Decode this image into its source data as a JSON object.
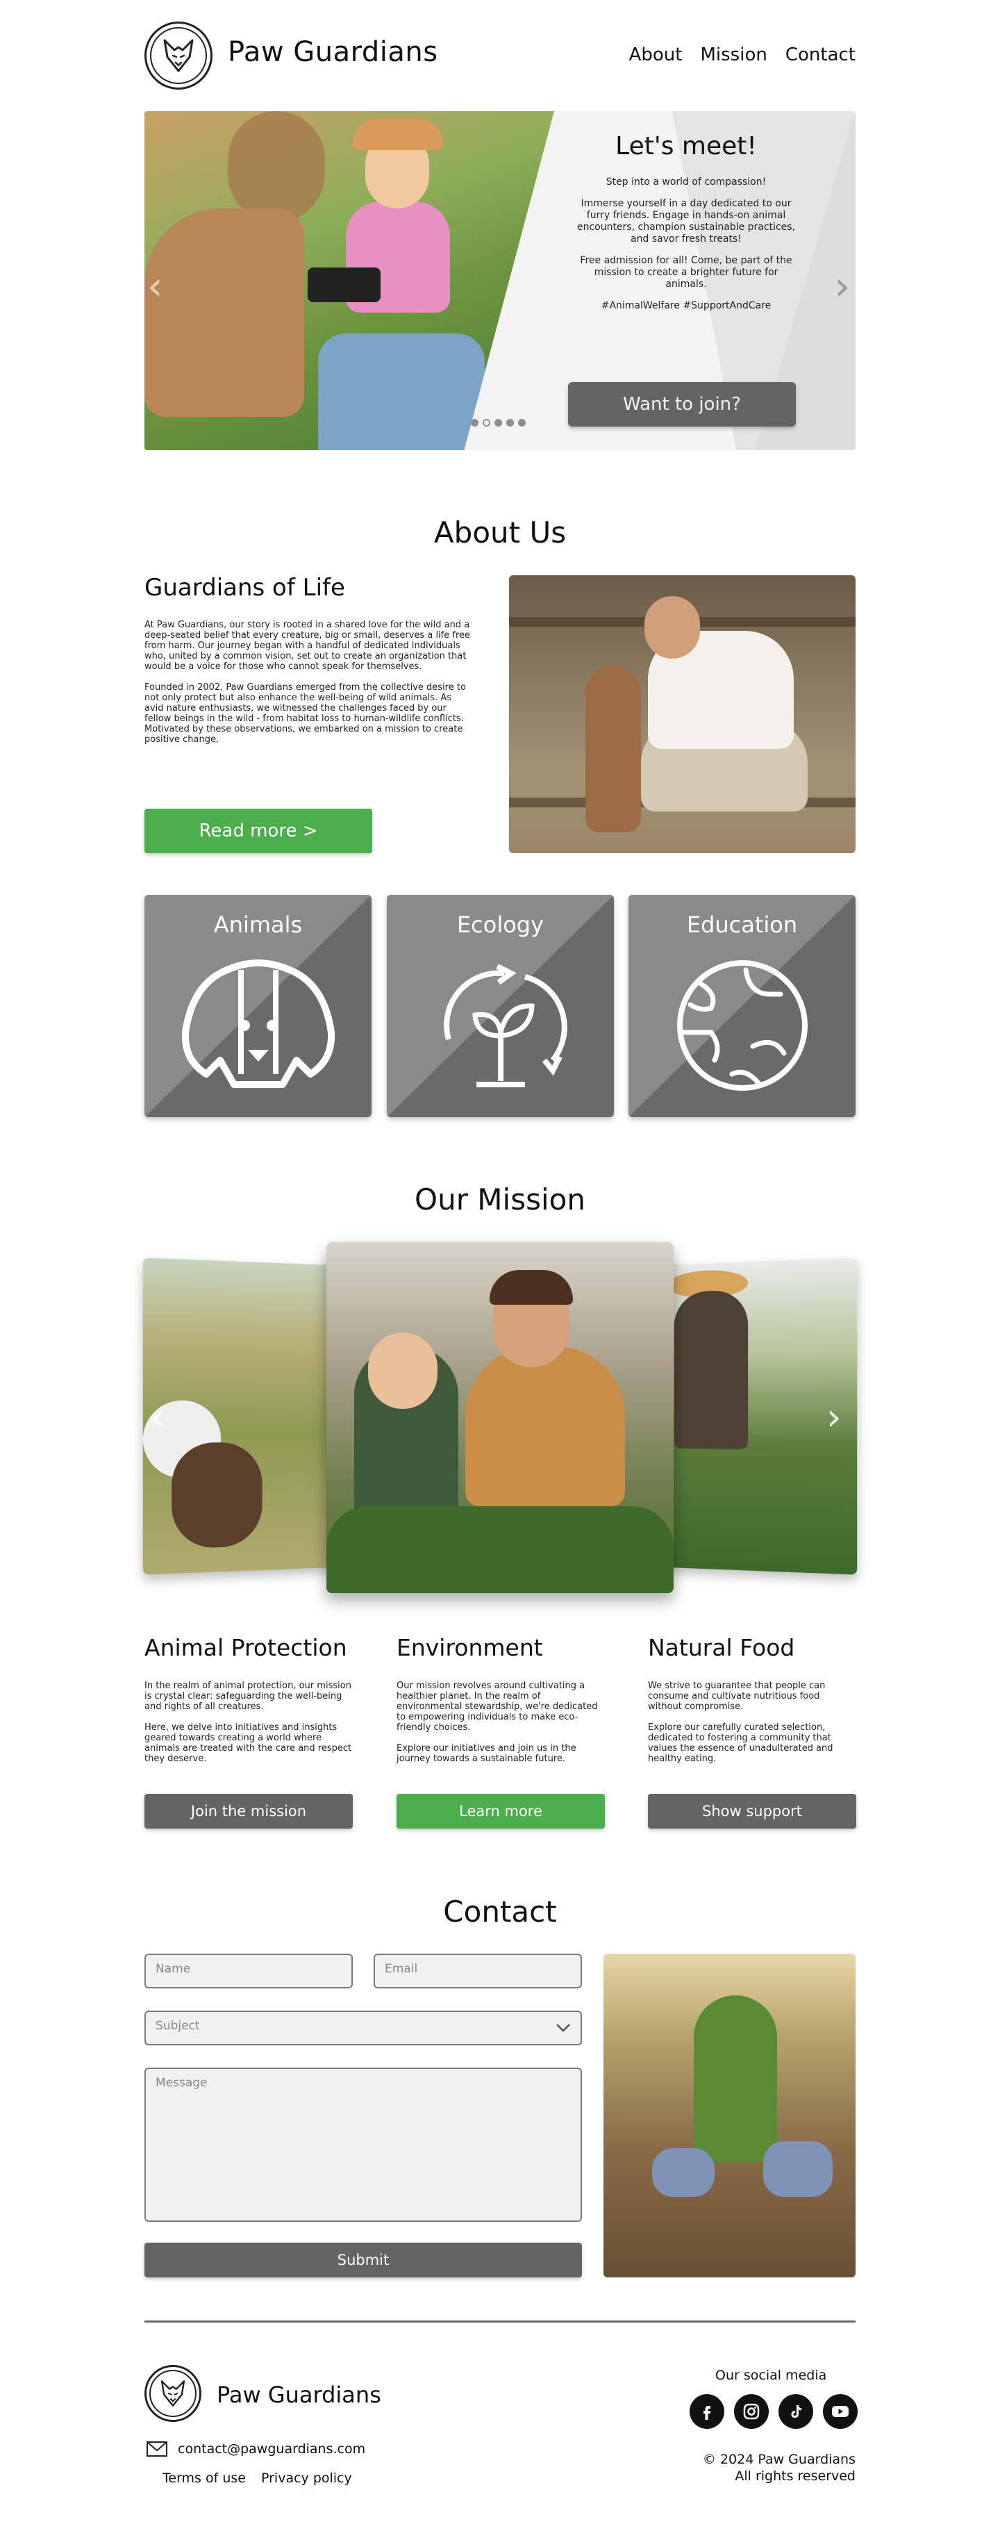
{
  "header": {
    "brand": "Paw Guardians",
    "nav": [
      "About",
      "Mission",
      "Contact"
    ]
  },
  "hero": {
    "title": "Let's meet!",
    "paragraphs": [
      "Step into a world of compassion!",
      "Immerse yourself in a day dedicated to our furry friends. Engage in hands-on animal encounters, champion sustainable practices, and savor fresh treats!",
      "Free admission for all! Come, be part of the mission to create a brighter future for animals.",
      "#AnimalWelfare #SupportAndCare"
    ],
    "button": "Want to join?",
    "slide_count": 5,
    "active_slide": 1
  },
  "about": {
    "title": "About Us",
    "subtitle": "Guardians of Life",
    "paragraphs": [
      "At Paw Guardians, our story is rooted in a shared love for the wild and a deep-seated belief that every creature, big or small, deserves a life free from harm. Our journey began with a handful of dedicated individuals who, united by a common vision, set out to create an organization that would be a voice for those who cannot speak for themselves.",
      "Founded in 2002, Paw Guardians emerged from the collective desire to not only protect but also enhance the well-being of wild animals. As avid nature enthusiasts, we witnessed the challenges faced by our fellow beings in the wild - from habitat loss to human-wildlife conflicts. Motivated by these observations, we embarked on a mission to create positive change."
    ],
    "button": "Read more  >"
  },
  "cards": [
    {
      "label": "Animals",
      "icon": "dog-icon"
    },
    {
      "label": "Ecology",
      "icon": "sprout-cycle-icon"
    },
    {
      "label": "Education",
      "icon": "globe-icon"
    }
  ],
  "mission": {
    "title": "Our Mission",
    "columns": [
      {
        "title": "Animal Protection",
        "paragraphs": [
          "In the realm of animal protection, our mission is crystal clear: safeguarding the well-being and rights of all creatures.",
          "Here, we delve into initiatives and insights geared towards creating a world where animals are treated with the care and respect they deserve."
        ],
        "button": "Join the mission"
      },
      {
        "title": "Environment",
        "paragraphs": [
          "Our mission revolves around cultivating a healthier planet. In the realm of environmental stewardship, we're dedicated to empowering individuals to make eco-friendly choices.",
          "Explore our initiatives and join us in the journey towards a sustainable future."
        ],
        "button": "Learn more"
      },
      {
        "title": "Natural Food",
        "paragraphs": [
          "We strive to guarantee that people can consume and cultivate nutritious food without compromise.",
          "Explore our carefully curated selection, dedicated to fostering a community that values the essence of unadulterated and healthy eating."
        ],
        "button": "Show support"
      }
    ]
  },
  "contact": {
    "title": "Contact",
    "name_placeholder": "Name",
    "email_placeholder": "Email",
    "subject_placeholder": "Subject",
    "message_placeholder": "Message",
    "submit": "Submit"
  },
  "footer": {
    "brand": "Paw Guardians",
    "email": "contact@pawguardians.com",
    "terms": "Terms of use",
    "privacy": "Privacy policy",
    "social_label": "Our social media",
    "social": [
      "facebook-icon",
      "instagram-icon",
      "tiktok-icon",
      "youtube-icon"
    ],
    "copyright": "© 2024 Paw Guardians",
    "rights": "All rights reserved"
  },
  "colors": {
    "accent_green": "#4cae4c",
    "button_gray": "#646464",
    "card_dark": "#6a6a6a",
    "card_light": "#8a8a8a"
  }
}
